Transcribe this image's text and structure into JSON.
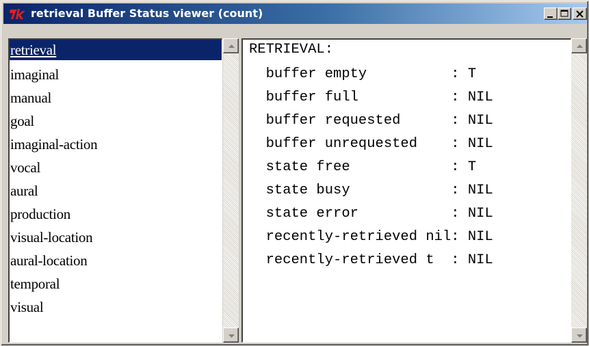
{
  "window": {
    "title": "retrieval Buffer Status viewer (count)",
    "icon": "tk-feather-icon",
    "controls": {
      "minimize": "minimize-icon",
      "maximize": "maximize-icon",
      "close": "close-icon"
    }
  },
  "buffers": {
    "selected": "retrieval",
    "items": [
      {
        "label": "retrieval"
      },
      {
        "label": "imaginal"
      },
      {
        "label": "manual"
      },
      {
        "label": "goal"
      },
      {
        "label": "imaginal-action"
      },
      {
        "label": "vocal"
      },
      {
        "label": "aural"
      },
      {
        "label": "production"
      },
      {
        "label": "visual-location"
      },
      {
        "label": "aural-location"
      },
      {
        "label": "temporal"
      },
      {
        "label": "visual"
      }
    ]
  },
  "status": {
    "header": "RETRIEVAL:",
    "lines": [
      "  buffer empty          : T",
      "  buffer full           : NIL",
      "  buffer requested      : NIL",
      "  buffer unrequested    : NIL",
      "  state free            : T",
      "  state busy            : NIL",
      "  state error           : NIL",
      "  recently-retrieved nil: NIL",
      "  recently-retrieved t  : NIL"
    ]
  },
  "colors": {
    "titlebar_start": "#0a246a",
    "titlebar_end": "#a6caf0",
    "selection": "#0a246a",
    "face": "#d4d0c8"
  }
}
